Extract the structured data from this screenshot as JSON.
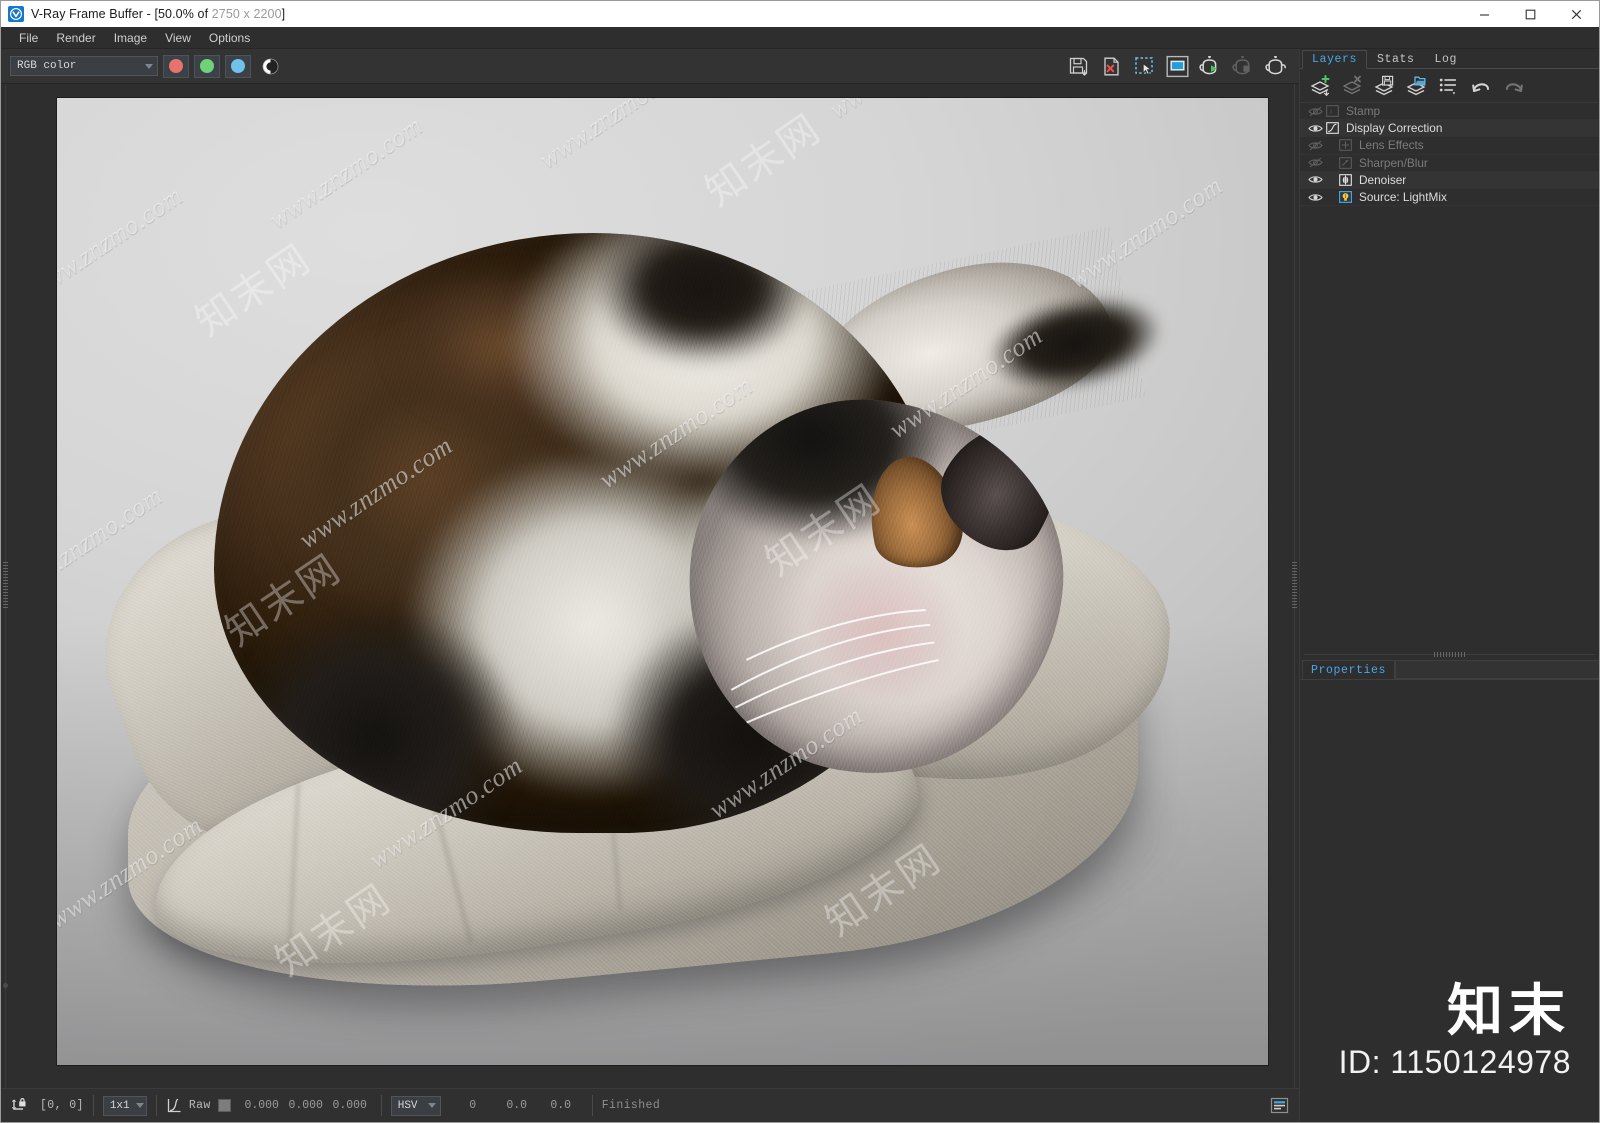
{
  "window": {
    "title_prefix": "V-Ray Frame Buffer - ",
    "title_zoom": "[50.0% of ",
    "title_res": "2750 x 2200",
    "title_suffix": "]",
    "app_icon": "vray-logo-icon",
    "minimize_label": "–",
    "maximize_label": "☐",
    "close_label": "✕"
  },
  "menubar": {
    "items": [
      {
        "label": "File",
        "name": "menu-file"
      },
      {
        "label": "Render",
        "name": "menu-render"
      },
      {
        "label": "Image",
        "name": "menu-image"
      },
      {
        "label": "View",
        "name": "menu-view"
      },
      {
        "label": "Options",
        "name": "menu-options"
      }
    ]
  },
  "toolbar": {
    "channel_select": {
      "value": "RGB color",
      "placeholder": "RGB color"
    },
    "channels": [
      {
        "name": "red-channel-button",
        "color": "#e8726e"
      },
      {
        "name": "green-channel-button",
        "color": "#6fd17a"
      },
      {
        "name": "blue-channel-button",
        "color": "#6fc3ea"
      }
    ],
    "mono_button": "monochrome-toggle-icon",
    "right_buttons": [
      {
        "name": "save-image-button",
        "icon": "save-icon"
      },
      {
        "name": "clear-image-button",
        "icon": "clear-image-icon"
      },
      {
        "name": "region-select-button",
        "icon": "marquee-select-icon"
      },
      {
        "name": "render-region-button",
        "icon": "render-region-icon",
        "active": true
      },
      {
        "name": "start-render-button",
        "icon": "teapot-play-icon"
      },
      {
        "name": "stop-render-button",
        "icon": "teapot-stop-icon",
        "disabled": true
      },
      {
        "name": "render-last-button",
        "icon": "teapot-icon"
      }
    ]
  },
  "render_image": {
    "zoom_percent": "50.0%",
    "resolution": "2750 x 2200",
    "watermarks": [
      "www.znzmo.com",
      "www.znzmo.com",
      "www.znzmo.com",
      "www.znzmo.com",
      "www.znzmo.com",
      "www.znzmo.com",
      "www.znzmo.com",
      "www.znzmo.com",
      "www.znzmo.com",
      "www.znzmo.com",
      "www.znzmo.com",
      "www.znzmo.com"
    ],
    "cn_watermarks": [
      "知末网",
      "知末网",
      "知末网",
      "知末网",
      "知末网",
      "知末网"
    ],
    "subject": "sleeping calico cat on a fabric pet cushion",
    "background_color": "#d0d0d0",
    "cushion_color": "#bdb7ac",
    "fur_brown": "#4a3020",
    "fur_dark": "#1c1714",
    "fur_white": "#ece9e2"
  },
  "statusbar": {
    "pick_icon": "pixel-lock-icon",
    "coords": "[0,  0]",
    "sample_size": {
      "value": "1x1"
    },
    "curve_icon": "color-curve-icon",
    "raw_label": "Raw",
    "swatch_color": "#7d7d7d",
    "rgb": [
      "0.000",
      "0.000",
      "0.000"
    ],
    "color_space": {
      "value": "HSV"
    },
    "hsv": [
      "0",
      "0.0",
      "0.0"
    ],
    "status_message": "Finished",
    "right_icon": "log-panel-icon"
  },
  "right_panel": {
    "tabs": [
      {
        "label": "Layers",
        "name": "tab-layers",
        "active": true
      },
      {
        "label": "Stats",
        "name": "tab-stats",
        "active": false
      },
      {
        "label": "Log",
        "name": "tab-log",
        "active": false
      }
    ],
    "layer_toolbar": [
      {
        "name": "add-layer-button",
        "icon": "layer-add-icon"
      },
      {
        "name": "delete-layer-button",
        "icon": "layer-delete-icon",
        "disabled": true
      },
      {
        "name": "save-layers-button",
        "icon": "layer-save-icon"
      },
      {
        "name": "load-layers-button",
        "icon": "layer-open-icon"
      },
      {
        "name": "layer-menu-button",
        "icon": "list-menu-icon"
      },
      {
        "name": "undo-button",
        "icon": "undo-arrow-icon"
      },
      {
        "name": "redo-button",
        "icon": "redo-arrow-icon",
        "disabled": true
      }
    ],
    "layers": [
      {
        "label": "Stamp",
        "name": "layer-stamp",
        "enabled": false,
        "indent": false,
        "icon": "stamp-icon"
      },
      {
        "label": "Display Correction",
        "name": "layer-display-correction",
        "enabled": true,
        "indent": false,
        "icon": "curve-icon"
      },
      {
        "label": "Lens Effects",
        "name": "layer-lens-effects",
        "enabled": false,
        "indent": true,
        "icon": "lens-cross-icon"
      },
      {
        "label": "Sharpen/Blur",
        "name": "layer-sharpen-blur",
        "enabled": false,
        "indent": true,
        "icon": "sharpen-icon"
      },
      {
        "label": "Denoiser",
        "name": "layer-denoiser",
        "enabled": true,
        "indent": true,
        "icon": "denoiser-icon"
      },
      {
        "label": "Source: LightMix",
        "name": "layer-source-lightmix",
        "enabled": true,
        "indent": true,
        "icon": "lightmix-bulb-icon"
      }
    ],
    "properties": {
      "tab_label": "Properties",
      "name": "tab-properties"
    }
  },
  "overlay_watermark": {
    "brand": "知末",
    "id_text": "ID: 1150124978"
  }
}
